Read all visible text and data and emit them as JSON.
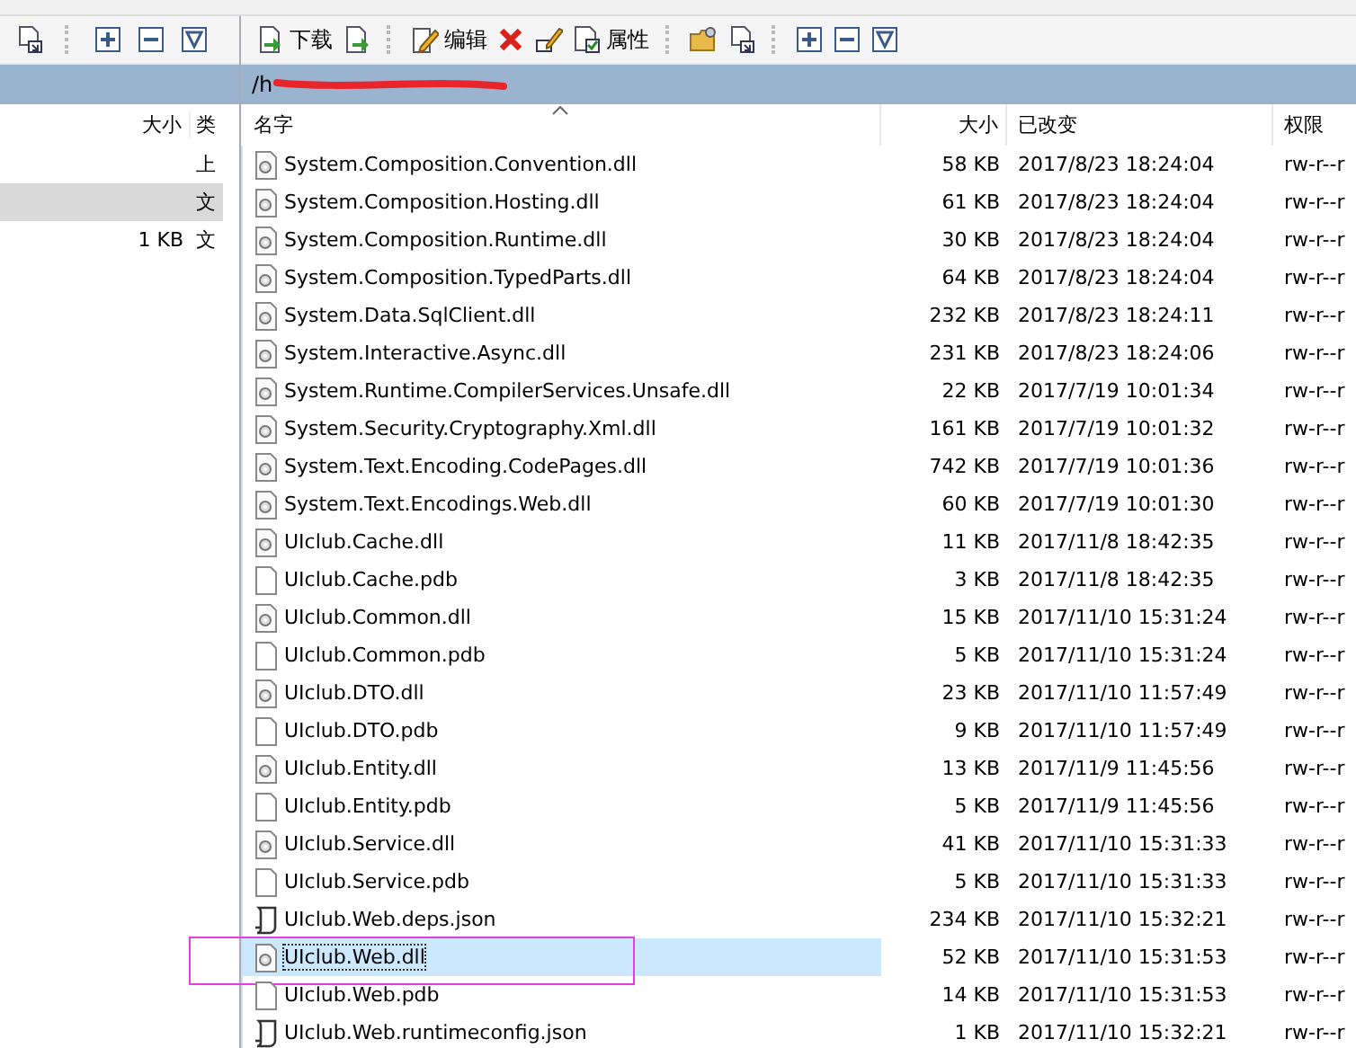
{
  "left_panel": {
    "toolbar": {
      "buttons": [
        {
          "kind": "doc"
        },
        {
          "kind": "plus"
        },
        {
          "kind": "minus"
        },
        {
          "kind": "filter"
        }
      ]
    },
    "columns": [
      "大小",
      "类"
    ],
    "rows": [
      {
        "size": "",
        "type": "上",
        "selected": false
      },
      {
        "size": "",
        "type": "文",
        "selected": true
      },
      {
        "size": "1 KB",
        "type": "文",
        "selected": false
      }
    ]
  },
  "right_panel": {
    "toolbar": {
      "buttons": [
        {
          "kind": "download",
          "label": "下载"
        },
        {
          "kind": "download2"
        },
        {
          "kind": "sep"
        },
        {
          "kind": "edit",
          "label": "编辑"
        },
        {
          "kind": "delete"
        },
        {
          "kind": "rename"
        },
        {
          "kind": "properties",
          "label": "属性"
        },
        {
          "kind": "sep"
        },
        {
          "kind": "newfolder"
        },
        {
          "kind": "doc"
        },
        {
          "kind": "sep"
        },
        {
          "kind": "plus"
        },
        {
          "kind": "minus"
        },
        {
          "kind": "filter"
        }
      ]
    },
    "path": "/h",
    "path_redacted": true,
    "columns": [
      "名字",
      "大小",
      "已改变",
      "权限"
    ],
    "rows": [
      {
        "kind": "dll",
        "name": "System.Composition.Convention.dll",
        "size": "58 KB",
        "changed": "2017/8/23 18:24:04",
        "rights": "rw-r--r",
        "selected": false,
        "annotated": false
      },
      {
        "kind": "dll",
        "name": "System.Composition.Hosting.dll",
        "size": "61 KB",
        "changed": "2017/8/23 18:24:04",
        "rights": "rw-r--r",
        "selected": false,
        "annotated": false
      },
      {
        "kind": "dll",
        "name": "System.Composition.Runtime.dll",
        "size": "30 KB",
        "changed": "2017/8/23 18:24:04",
        "rights": "rw-r--r",
        "selected": false,
        "annotated": false
      },
      {
        "kind": "dll",
        "name": "System.Composition.TypedParts.dll",
        "size": "64 KB",
        "changed": "2017/8/23 18:24:04",
        "rights": "rw-r--r",
        "selected": false,
        "annotated": false
      },
      {
        "kind": "dll",
        "name": "System.Data.SqlClient.dll",
        "size": "232 KB",
        "changed": "2017/8/23 18:24:11",
        "rights": "rw-r--r",
        "selected": false,
        "annotated": false
      },
      {
        "kind": "dll",
        "name": "System.Interactive.Async.dll",
        "size": "231 KB",
        "changed": "2017/8/23 18:24:06",
        "rights": "rw-r--r",
        "selected": false,
        "annotated": false
      },
      {
        "kind": "dll",
        "name": "System.Runtime.CompilerServices.Unsafe.dll",
        "size": "22 KB",
        "changed": "2017/7/19 10:01:34",
        "rights": "rw-r--r",
        "selected": false,
        "annotated": false
      },
      {
        "kind": "dll",
        "name": "System.Security.Cryptography.Xml.dll",
        "size": "161 KB",
        "changed": "2017/7/19 10:01:32",
        "rights": "rw-r--r",
        "selected": false,
        "annotated": false
      },
      {
        "kind": "dll",
        "name": "System.Text.Encoding.CodePages.dll",
        "size": "742 KB",
        "changed": "2017/7/19 10:01:36",
        "rights": "rw-r--r",
        "selected": false,
        "annotated": false
      },
      {
        "kind": "dll",
        "name": "System.Text.Encodings.Web.dll",
        "size": "60 KB",
        "changed": "2017/7/19 10:01:30",
        "rights": "rw-r--r",
        "selected": false,
        "annotated": false
      },
      {
        "kind": "dll",
        "name": "UIclub.Cache.dll",
        "size": "11 KB",
        "changed": "2017/11/8 18:42:35",
        "rights": "rw-r--r",
        "selected": false,
        "annotated": false
      },
      {
        "kind": "file",
        "name": "UIclub.Cache.pdb",
        "size": "3 KB",
        "changed": "2017/11/8 18:42:35",
        "rights": "rw-r--r",
        "selected": false,
        "annotated": false
      },
      {
        "kind": "dll",
        "name": "UIclub.Common.dll",
        "size": "15 KB",
        "changed": "2017/11/10 15:31:24",
        "rights": "rw-r--r",
        "selected": false,
        "annotated": false
      },
      {
        "kind": "file",
        "name": "UIclub.Common.pdb",
        "size": "5 KB",
        "changed": "2017/11/10 15:31:24",
        "rights": "rw-r--r",
        "selected": false,
        "annotated": false
      },
      {
        "kind": "dll",
        "name": "UIclub.DTO.dll",
        "size": "23 KB",
        "changed": "2017/11/10 11:57:49",
        "rights": "rw-r--r",
        "selected": false,
        "annotated": false
      },
      {
        "kind": "file",
        "name": "UIclub.DTO.pdb",
        "size": "9 KB",
        "changed": "2017/11/10 11:57:49",
        "rights": "rw-r--r",
        "selected": false,
        "annotated": false
      },
      {
        "kind": "dll",
        "name": "UIclub.Entity.dll",
        "size": "13 KB",
        "changed": "2017/11/9 11:45:56",
        "rights": "rw-r--r",
        "selected": false,
        "annotated": false
      },
      {
        "kind": "file",
        "name": "UIclub.Entity.pdb",
        "size": "5 KB",
        "changed": "2017/11/9 11:45:56",
        "rights": "rw-r--r",
        "selected": false,
        "annotated": false
      },
      {
        "kind": "dll",
        "name": "UIclub.Service.dll",
        "size": "41 KB",
        "changed": "2017/11/10 15:31:33",
        "rights": "rw-r--r",
        "selected": false,
        "annotated": false
      },
      {
        "kind": "file",
        "name": "UIclub.Service.pdb",
        "size": "5 KB",
        "changed": "2017/11/10 15:31:33",
        "rights": "rw-r--r",
        "selected": false,
        "annotated": false
      },
      {
        "kind": "script",
        "name": "UIclub.Web.deps.json",
        "size": "234 KB",
        "changed": "2017/11/10 15:32:21",
        "rights": "rw-r--r",
        "selected": false,
        "annotated": false
      },
      {
        "kind": "dll",
        "name": "UIclub.Web.dll",
        "size": "52 KB",
        "changed": "2017/11/10 15:31:53",
        "rights": "rw-r--r",
        "selected": true,
        "annotated": true
      },
      {
        "kind": "file",
        "name": "UIclub.Web.pdb",
        "size": "14 KB",
        "changed": "2017/11/10 15:31:53",
        "rights": "rw-r--r",
        "selected": false,
        "annotated": false
      },
      {
        "kind": "script",
        "name": "UIclub.Web.runtimeconfig.json",
        "size": "1 KB",
        "changed": "2017/11/10 15:32:21",
        "rights": "rw-r--r",
        "selected": false,
        "annotated": false
      }
    ]
  }
}
